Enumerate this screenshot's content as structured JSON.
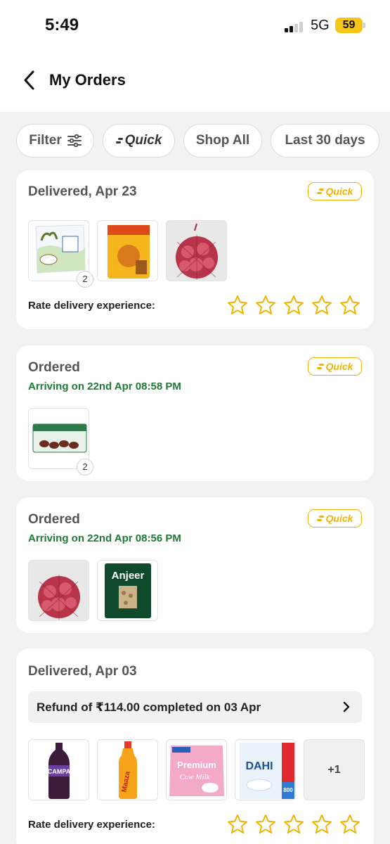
{
  "status_bar": {
    "time": "5:49",
    "network": "5G",
    "battery": "59"
  },
  "header": {
    "title": "My Orders",
    "back_icon": "chevron-left-icon"
  },
  "filters": {
    "filter_label": "Filter",
    "filter_icon": "sliders-icon",
    "quick_label": "Quick",
    "shop_all_label": "Shop All",
    "date_label": "Last 30 days"
  },
  "colors": {
    "accent": "#f0b400",
    "arriving": "#1e7a35",
    "star": "#f0b400"
  },
  "orders": [
    {
      "title": "Delivered, Apr 23",
      "badge": "Quick",
      "items": [
        {
          "name": "amul-milk-pouch",
          "qty": "2"
        },
        {
          "name": "aashirvaad-snack-pack"
        },
        {
          "name": "onion-net-bag"
        }
      ],
      "rate_label": "Rate delivery experience:",
      "rating": 0
    },
    {
      "title": "Ordered",
      "arriving": "Arriving on 22nd Apr 08:58 PM",
      "badge": "Quick",
      "items": [
        {
          "name": "dates-pack",
          "qty": "2"
        }
      ]
    },
    {
      "title": "Ordered",
      "arriving": "Arriving on 22nd Apr 08:56 PM",
      "badge": "Quick",
      "items": [
        {
          "name": "onion-net-bag"
        },
        {
          "name": "anjeer-pack",
          "label": "Anjeer"
        }
      ]
    },
    {
      "title": "Delivered, Apr 03",
      "refund": "Refund of ₹114.00 completed on 03 Apr",
      "items": [
        {
          "name": "campa-cola-bottle",
          "label": "CAMPA"
        },
        {
          "name": "maaza-bottle",
          "label": "Maaza"
        },
        {
          "name": "premium-cow-milk",
          "label": "Premium",
          "label2": "Cow Milk"
        },
        {
          "name": "amul-dahi",
          "label": "DAHI",
          "label2": "800"
        },
        {
          "name": "more-items",
          "more": "+1"
        }
      ],
      "rate_label": "Rate delivery experience:",
      "rating": 0
    }
  ]
}
